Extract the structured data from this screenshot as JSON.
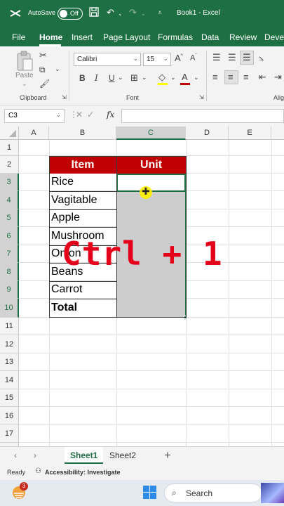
{
  "titlebar": {
    "autosave_label": "AutoSave",
    "autosave_state": "Off",
    "document_title": "Book1  -  Excel"
  },
  "tabs": [
    "File",
    "Home",
    "Insert",
    "Page Layout",
    "Formulas",
    "Data",
    "Review",
    "Deve"
  ],
  "active_tab": "Home",
  "ribbon": {
    "clipboard": {
      "paste_label": "Paste",
      "group_label": "Clipboard"
    },
    "font": {
      "font_name": "Calibri",
      "font_size": "15",
      "group_label": "Font"
    },
    "alignment": {
      "group_label": "Alig"
    }
  },
  "formula_bar": {
    "name_box": "C3",
    "fx_label": "fx",
    "formula": ""
  },
  "columns": [
    "A",
    "B",
    "C",
    "D",
    "E"
  ],
  "selected_column": "C",
  "rows": [
    "1",
    "2",
    "3",
    "4",
    "5",
    "6",
    "7",
    "8",
    "9",
    "10",
    "11",
    "12",
    "13",
    "14",
    "15",
    "16",
    "17"
  ],
  "selected_rows": [
    "3",
    "4",
    "5",
    "6",
    "7",
    "8",
    "9",
    "10"
  ],
  "table": {
    "headers": [
      "Item",
      "Unit"
    ],
    "items": [
      "Rice",
      "Vagitable",
      "Apple",
      "Mushroom",
      "Onion",
      "Beans",
      "Carrot"
    ],
    "total_label": "Total"
  },
  "overlay_text": "Ctrl + 1",
  "sheet_tabs": [
    "Sheet1",
    "Sheet2"
  ],
  "active_sheet": "Sheet1",
  "status": {
    "ready": "Ready",
    "accessibility": "Accessibility: Investigate"
  },
  "taskbar": {
    "search_placeholder": "Search",
    "notification_count": "3"
  },
  "colors": {
    "excel_green": "#1e6f43",
    "header_red": "#c00000",
    "overlay_red": "#e4001b"
  }
}
